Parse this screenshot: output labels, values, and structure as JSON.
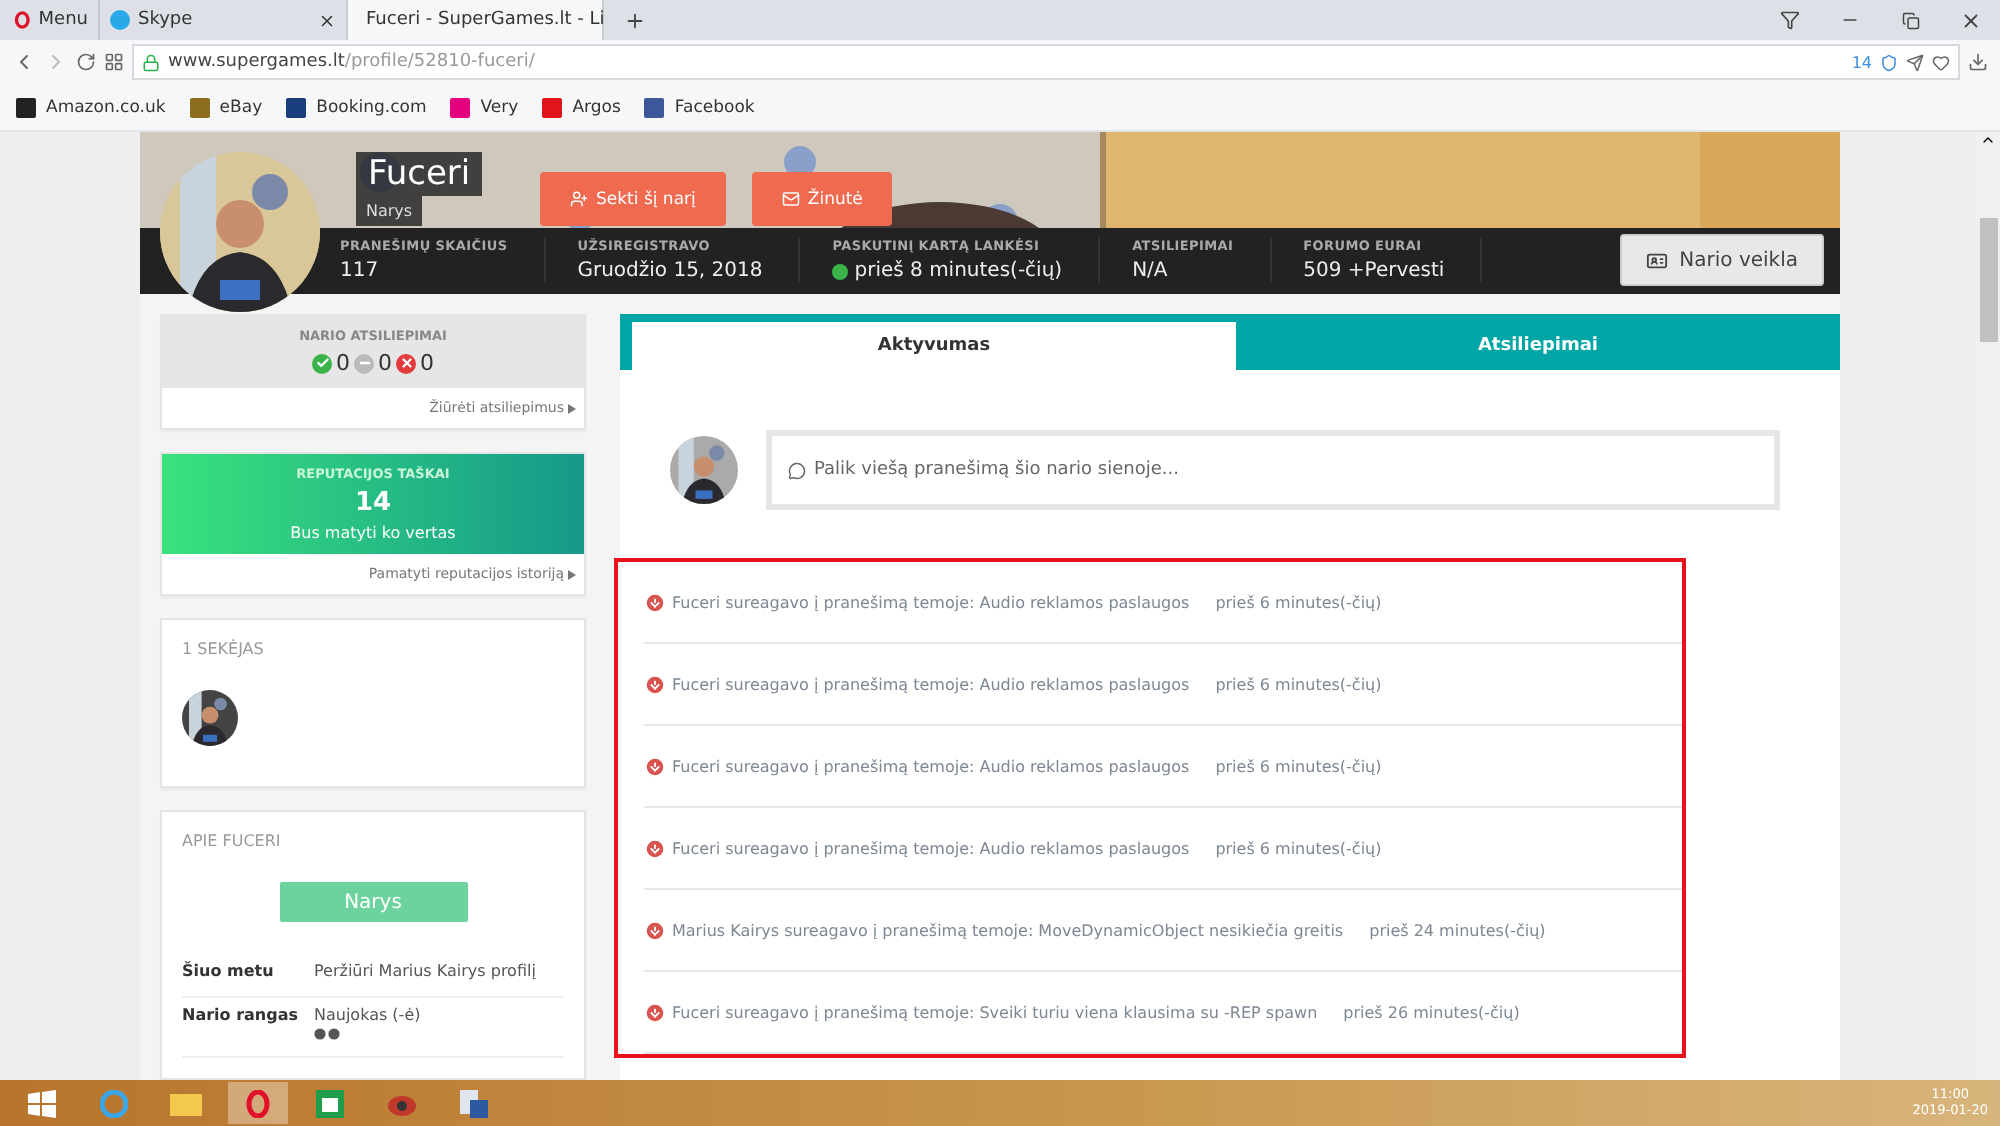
{
  "browser": {
    "tabs": [
      {
        "label": "Menu",
        "kind": "menu",
        "selected": false
      },
      {
        "label": "Skype",
        "kind": "skype",
        "selected": false
      },
      {
        "label": "Fuceri - SuperGames.lt - Li",
        "kind": "site",
        "selected": true
      }
    ],
    "address": {
      "host": "www.supergames.lt",
      "path": "/profile/52810-fuceri/"
    },
    "tracker_count": "14",
    "bookmarks": [
      {
        "label": "Amazon.co.uk",
        "color": "#222222"
      },
      {
        "label": "eBay",
        "color": "#8a6d1f"
      },
      {
        "label": "Booking.com",
        "color": "#1a3d7c"
      },
      {
        "label": "Very",
        "color": "#e4007c"
      },
      {
        "label": "Argos",
        "color": "#e1141b"
      },
      {
        "label": "Facebook",
        "color": "#3b5998"
      }
    ]
  },
  "profile": {
    "name": "Fuceri",
    "role": "Narys",
    "buttons": [
      {
        "label": "Sekti šį narį",
        "kind": "follow"
      },
      {
        "label": "Žinutė",
        "kind": "message"
      }
    ],
    "stats": [
      {
        "label": "PRANEŠIMŲ SKAIČIUS",
        "value": "117",
        "online": false
      },
      {
        "label": "UŽSIREGISTRAVO",
        "value": "Gruodžio 15, 2018",
        "online": false
      },
      {
        "label": "PASKUTINĮ KARTĄ LANKĖSI",
        "value": "prieš 8 minutes(-čių)",
        "online": true
      },
      {
        "label": "ATSILIEPIMAI",
        "value": "N/A",
        "online": false
      },
      {
        "label": "FORUMO EURAI",
        "value": "509 +Pervesti",
        "online": false
      }
    ],
    "activity_button": "Nario veikla"
  },
  "sidebar": {
    "feedback": {
      "title": "NARIO ATSILIEPIMAI",
      "positive": "0",
      "neutral": "0",
      "negative": "0",
      "link": "Žiūrėti atsiliepimus"
    },
    "reputation": {
      "title": "REPUTACIJOS TAŠKAI",
      "points": "14",
      "caption": "Bus matyti ko vertas",
      "link": "Pamatyti reputacijos istoriją"
    },
    "followers": {
      "title": "1 SEKĖJAS"
    },
    "about": {
      "title": "APIE FUCERI",
      "group": "Narys",
      "rows": [
        {
          "label": "Šiuo metu",
          "value": "Peržiūri Marius Kairys profilį",
          "kind": "text"
        },
        {
          "label": "Nario rangas",
          "value": "Naujokas (-ė)",
          "kind": "rank"
        }
      ]
    }
  },
  "content_tabs": [
    {
      "label": "Aktyvumas",
      "selected": true
    },
    {
      "label": "Atsiliepimai",
      "selected": false
    }
  ],
  "post_placeholder": "Palik viešą pranešimą šio nario sienoje...",
  "activities": [
    {
      "text": "Fuceri sureagavo į pranešimą temoje: Audio reklamos paslaugos",
      "time": "prieš 6 minutes(-čių)"
    },
    {
      "text": "Fuceri sureagavo į pranešimą temoje: Audio reklamos paslaugos",
      "time": "prieš 6 minutes(-čių)"
    },
    {
      "text": "Fuceri sureagavo į pranešimą temoje: Audio reklamos paslaugos",
      "time": "prieš 6 minutes(-čių)"
    },
    {
      "text": "Fuceri sureagavo į pranešimą temoje: Audio reklamos paslaugos",
      "time": "prieš 6 minutes(-čių)"
    },
    {
      "text": "Marius Kairys sureagavo į pranešimą temoje: MoveDynamicObject nesikiečia greitis",
      "time": "prieš 24 minutes(-čių)"
    },
    {
      "text": "Fuceri sureagavo į pranešimą temoje: Sveiki turiu viena klausima su -REP spawn",
      "time": "prieš 26 minutes(-čių)"
    }
  ],
  "taskbar": {
    "time": "11:00",
    "date": "2019-01-20"
  }
}
